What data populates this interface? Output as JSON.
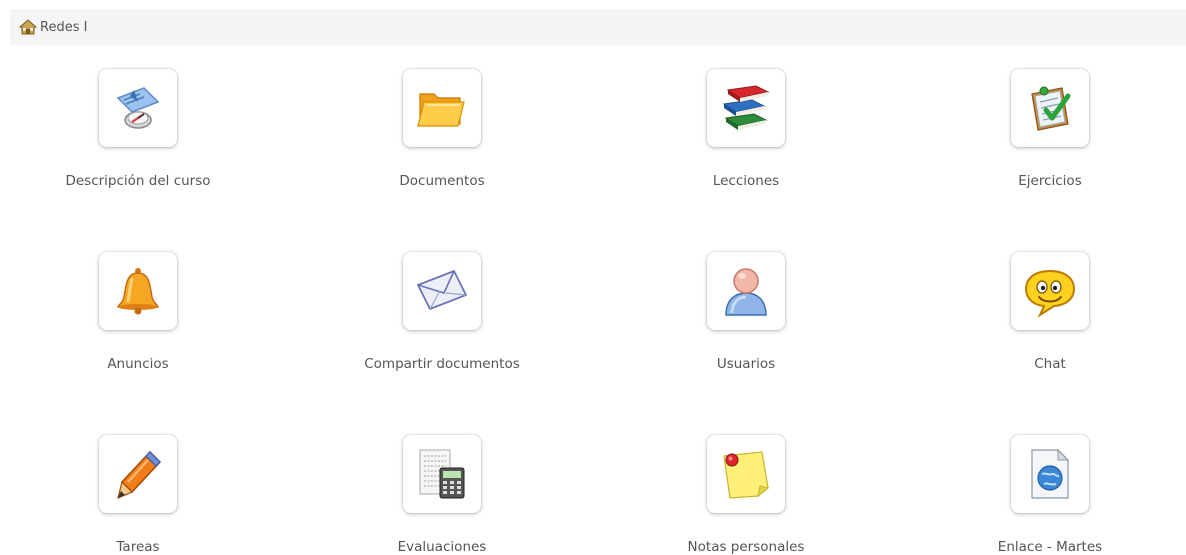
{
  "breadcrumb": {
    "icon": "home-icon",
    "label": "Redes I"
  },
  "tools": [
    {
      "label": "Descripción del curso",
      "icon": "course-description-icon"
    },
    {
      "label": "Documentos",
      "icon": "folder-icon"
    },
    {
      "label": "Lecciones",
      "icon": "books-icon"
    },
    {
      "label": "Ejercicios",
      "icon": "quiz-checklist-icon"
    },
    {
      "label": "Anuncios",
      "icon": "bell-icon"
    },
    {
      "label": "Compartir documentos",
      "icon": "envelope-icon"
    },
    {
      "label": "Usuarios",
      "icon": "user-icon"
    },
    {
      "label": "Chat",
      "icon": "chat-icon"
    },
    {
      "label": "Tareas",
      "icon": "pen-icon"
    },
    {
      "label": "Evaluaciones",
      "icon": "calculator-icon"
    },
    {
      "label": "Notas personales",
      "icon": "sticky-note-icon"
    },
    {
      "label": "Enlace - Martes",
      "icon": "link-document-icon"
    }
  ]
}
